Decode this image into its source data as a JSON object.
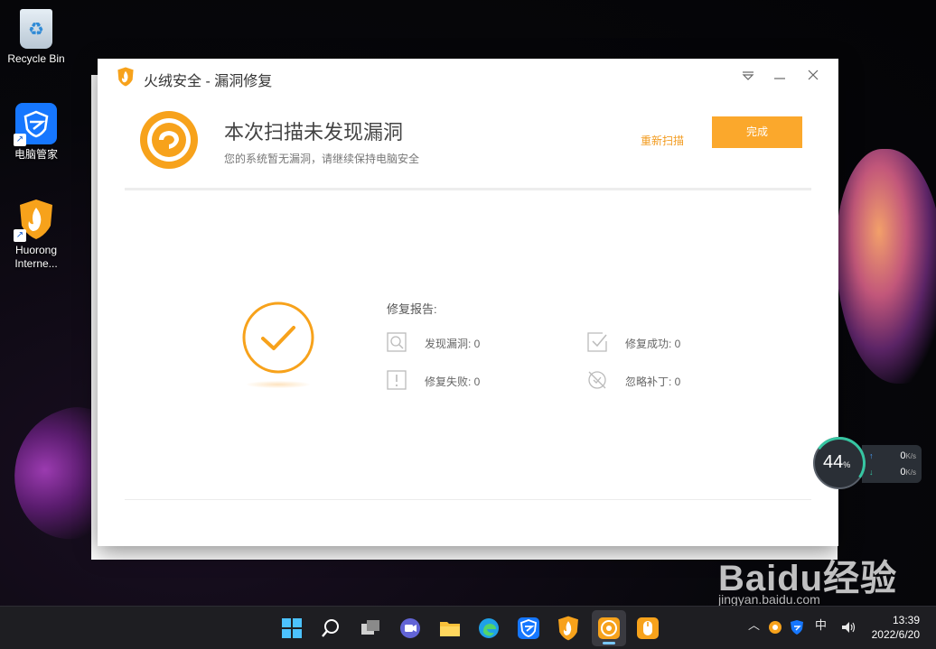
{
  "desktop": {
    "icons": [
      {
        "label": "Recycle Bin"
      },
      {
        "label": "电脑管家"
      },
      {
        "label": "Huorong Interne..."
      }
    ]
  },
  "window": {
    "title": "火绒安全 - 漏洞修复",
    "header": {
      "status_title": "本次扫描未发现漏洞",
      "status_sub": "您的系统暂无漏洞，请继续保持电脑安全",
      "rescan_label": "重新扫描",
      "done_label": "完成"
    },
    "report": {
      "title": "修复报告:",
      "stats": [
        {
          "label": "发现漏洞: 0",
          "icon": "search-icon"
        },
        {
          "label": "修复成功: 0",
          "icon": "check-box-icon"
        },
        {
          "label": "修复失败: 0",
          "icon": "alert-box-icon"
        },
        {
          "label": "忽略补丁: 0",
          "icon": "ignore-icon"
        }
      ]
    },
    "colors": {
      "accent": "#fba82c",
      "link": "#f29a1d"
    }
  },
  "network": {
    "percent": "44",
    "percent_unit": "%",
    "upload": "0",
    "download": "0",
    "unit": "K/s"
  },
  "taskbar": {
    "tray_ime": "中",
    "time": "13:39",
    "date": "2022/6/20"
  },
  "watermark": {
    "brand": "Baidu经验",
    "url": "jingyan.baidu.com"
  }
}
